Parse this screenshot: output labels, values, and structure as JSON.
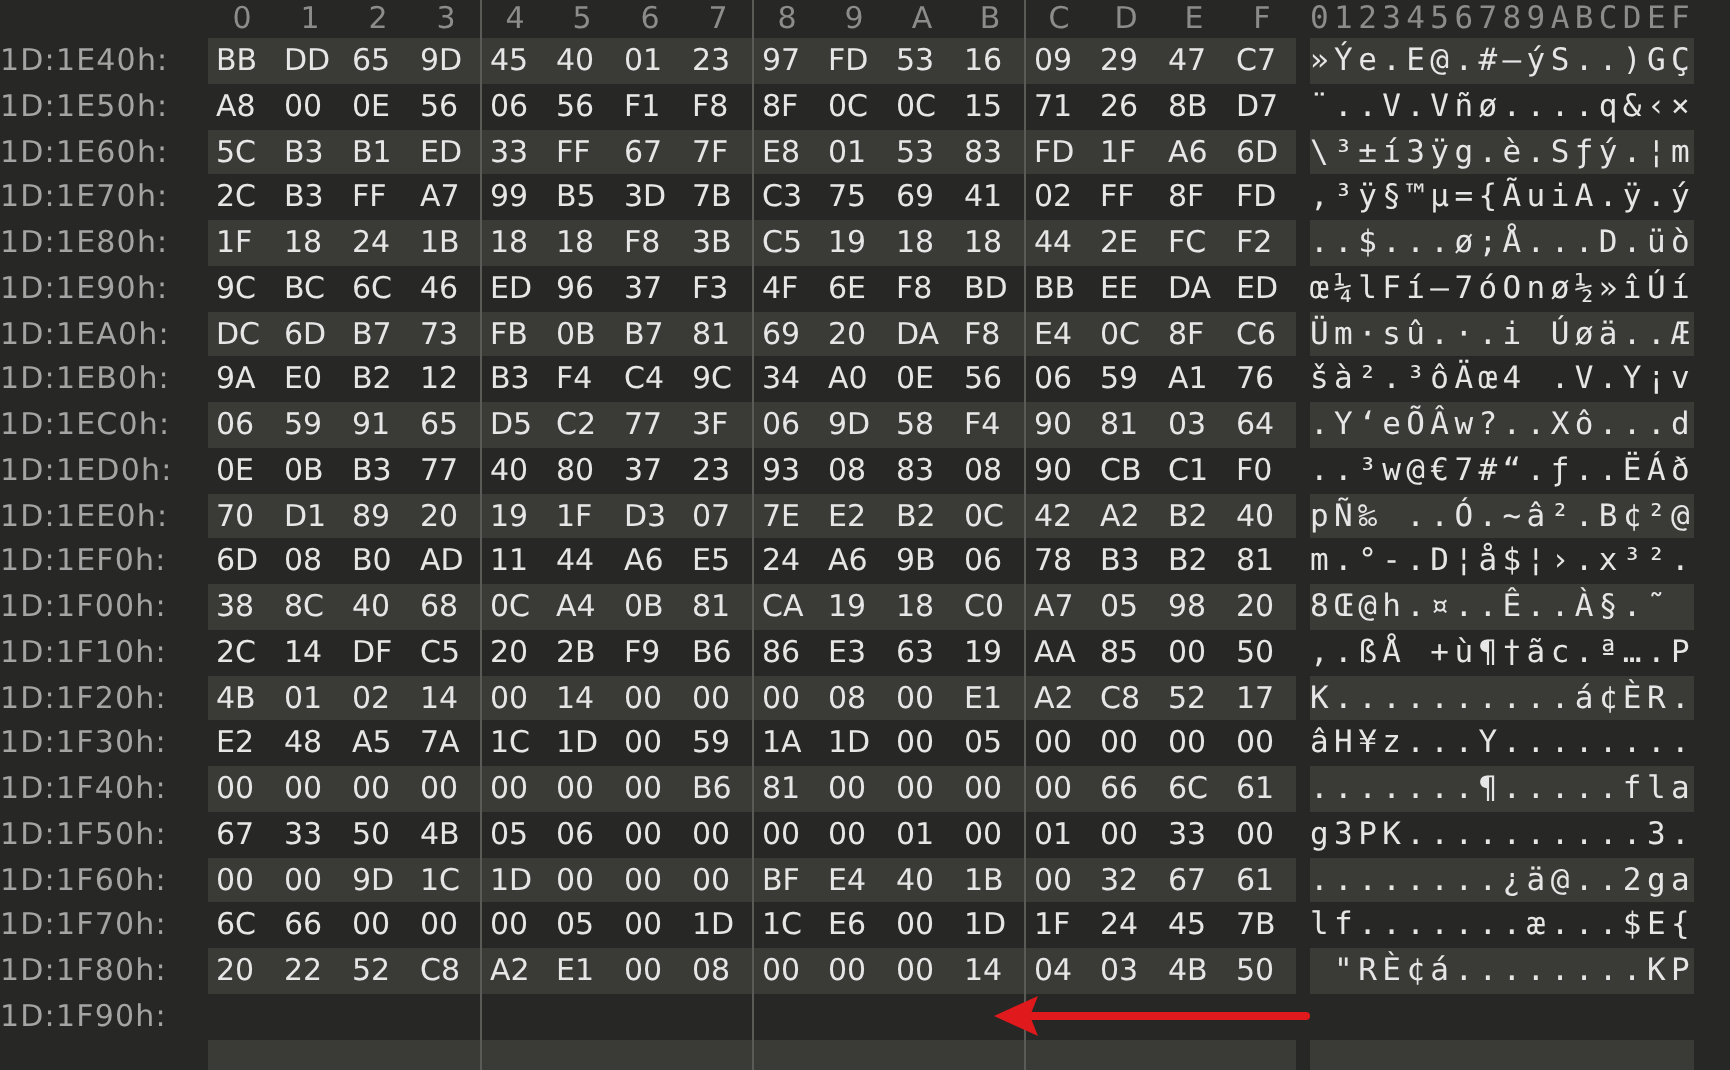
{
  "header": {
    "columns": [
      "0",
      "1",
      "2",
      "3",
      "4",
      "5",
      "6",
      "7",
      "8",
      "9",
      "A",
      "B",
      "C",
      "D",
      "E",
      "F"
    ],
    "ascii": "0123456789ABCDEF"
  },
  "rows": [
    {
      "address": "1D:1E40h:",
      "bytes": [
        "BB",
        "DD",
        "65",
        "9D",
        "45",
        "40",
        "01",
        "23",
        "97",
        "FD",
        "53",
        "16",
        "09",
        "29",
        "47",
        "C7"
      ],
      "ascii": "»Ýe.E@.#—ýS..)GÇ"
    },
    {
      "address": "1D:1E50h:",
      "bytes": [
        "A8",
        "00",
        "0E",
        "56",
        "06",
        "56",
        "F1",
        "F8",
        "8F",
        "0C",
        "0C",
        "15",
        "71",
        "26",
        "8B",
        "D7"
      ],
      "ascii": "¨..V.Vñø....q&‹×"
    },
    {
      "address": "1D:1E60h:",
      "bytes": [
        "5C",
        "B3",
        "B1",
        "ED",
        "33",
        "FF",
        "67",
        "7F",
        "E8",
        "01",
        "53",
        "83",
        "FD",
        "1F",
        "A6",
        "6D"
      ],
      "ascii": "\\³±í3ÿg.è.Sƒý.¦m"
    },
    {
      "address": "1D:1E70h:",
      "bytes": [
        "2C",
        "B3",
        "FF",
        "A7",
        "99",
        "B5",
        "3D",
        "7B",
        "C3",
        "75",
        "69",
        "41",
        "02",
        "FF",
        "8F",
        "FD"
      ],
      "ascii": ",³ÿ§™µ={ÃuiA.ÿ.ý"
    },
    {
      "address": "1D:1E80h:",
      "bytes": [
        "1F",
        "18",
        "24",
        "1B",
        "18",
        "18",
        "F8",
        "3B",
        "C5",
        "19",
        "18",
        "18",
        "44",
        "2E",
        "FC",
        "F2"
      ],
      "ascii": "..$...ø;Å...D.üò"
    },
    {
      "address": "1D:1E90h:",
      "bytes": [
        "9C",
        "BC",
        "6C",
        "46",
        "ED",
        "96",
        "37",
        "F3",
        "4F",
        "6E",
        "F8",
        "BD",
        "BB",
        "EE",
        "DA",
        "ED"
      ],
      "ascii": "œ¼lFí–7óOnø½»îÚí"
    },
    {
      "address": "1D:1EA0h:",
      "bytes": [
        "DC",
        "6D",
        "B7",
        "73",
        "FB",
        "0B",
        "B7",
        "81",
        "69",
        "20",
        "DA",
        "F8",
        "E4",
        "0C",
        "8F",
        "C6"
      ],
      "ascii": "Üm·sû.·.i Úøä..Æ"
    },
    {
      "address": "1D:1EB0h:",
      "bytes": [
        "9A",
        "E0",
        "B2",
        "12",
        "B3",
        "F4",
        "C4",
        "9C",
        "34",
        "A0",
        "0E",
        "56",
        "06",
        "59",
        "A1",
        "76"
      ],
      "ascii": "šà².³ôÄœ4 .V.Y¡v"
    },
    {
      "address": "1D:1EC0h:",
      "bytes": [
        "06",
        "59",
        "91",
        "65",
        "D5",
        "C2",
        "77",
        "3F",
        "06",
        "9D",
        "58",
        "F4",
        "90",
        "81",
        "03",
        "64"
      ],
      "ascii": ".Y‘eÕÂw?..Xô...d"
    },
    {
      "address": "1D:1ED0h:",
      "bytes": [
        "0E",
        "0B",
        "B3",
        "77",
        "40",
        "80",
        "37",
        "23",
        "93",
        "08",
        "83",
        "08",
        "90",
        "CB",
        "C1",
        "F0"
      ],
      "ascii": "..³w@€7#“.ƒ..ËÁð"
    },
    {
      "address": "1D:1EE0h:",
      "bytes": [
        "70",
        "D1",
        "89",
        "20",
        "19",
        "1F",
        "D3",
        "07",
        "7E",
        "E2",
        "B2",
        "0C",
        "42",
        "A2",
        "B2",
        "40"
      ],
      "ascii": "pÑ‰ ..Ó.~â².B¢²@"
    },
    {
      "address": "1D:1EF0h:",
      "bytes": [
        "6D",
        "08",
        "B0",
        "AD",
        "11",
        "44",
        "A6",
        "E5",
        "24",
        "A6",
        "9B",
        "06",
        "78",
        "B3",
        "B2",
        "81"
      ],
      "ascii": "m.°-.D¦å$¦›.x³²."
    },
    {
      "address": "1D:1F00h:",
      "bytes": [
        "38",
        "8C",
        "40",
        "68",
        "0C",
        "A4",
        "0B",
        "81",
        "CA",
        "19",
        "18",
        "C0",
        "A7",
        "05",
        "98",
        "20"
      ],
      "ascii": "8Œ@h.¤..Ê..À§.˜"
    },
    {
      "address": "1D:1F10h:",
      "bytes": [
        "2C",
        "14",
        "DF",
        "C5",
        "20",
        "2B",
        "F9",
        "B6",
        "86",
        "E3",
        "63",
        "19",
        "AA",
        "85",
        "00",
        "50"
      ],
      "ascii": ",.ßÅ +ù¶†ãc.ª….P"
    },
    {
      "address": "1D:1F20h:",
      "bytes": [
        "4B",
        "01",
        "02",
        "14",
        "00",
        "14",
        "00",
        "00",
        "00",
        "08",
        "00",
        "E1",
        "A2",
        "C8",
        "52",
        "17"
      ],
      "ascii": "K..........á¢ÈR."
    },
    {
      "address": "1D:1F30h:",
      "bytes": [
        "E2",
        "48",
        "A5",
        "7A",
        "1C",
        "1D",
        "00",
        "59",
        "1A",
        "1D",
        "00",
        "05",
        "00",
        "00",
        "00",
        "00"
      ],
      "ascii": "âH¥z...Y........"
    },
    {
      "address": "1D:1F40h:",
      "bytes": [
        "00",
        "00",
        "00",
        "00",
        "00",
        "00",
        "00",
        "B6",
        "81",
        "00",
        "00",
        "00",
        "00",
        "66",
        "6C",
        "61"
      ],
      "ascii": ".......¶.....fla"
    },
    {
      "address": "1D:1F50h:",
      "bytes": [
        "67",
        "33",
        "50",
        "4B",
        "05",
        "06",
        "00",
        "00",
        "00",
        "00",
        "01",
        "00",
        "01",
        "00",
        "33",
        "00"
      ],
      "ascii": "g3PK..........3."
    },
    {
      "address": "1D:1F60h:",
      "bytes": [
        "00",
        "00",
        "9D",
        "1C",
        "1D",
        "00",
        "00",
        "00",
        "BF",
        "E4",
        "40",
        "1B",
        "00",
        "32",
        "67",
        "61"
      ],
      "ascii": "........¿ä@..2ga"
    },
    {
      "address": "1D:1F70h:",
      "bytes": [
        "6C",
        "66",
        "00",
        "00",
        "00",
        "05",
        "00",
        "1D",
        "1C",
        "E6",
        "00",
        "1D",
        "1F",
        "24",
        "45",
        "7B"
      ],
      "ascii": "lf.......æ...$E{"
    },
    {
      "address": "1D:1F80h:",
      "bytes": [
        "20",
        "22",
        "52",
        "C8",
        "A2",
        "E1",
        "00",
        "08",
        "00",
        "00",
        "00",
        "14",
        "04",
        "03",
        "4B",
        "50"
      ],
      "ascii": " \"RÈ¢á........KP"
    },
    {
      "address": "1D:1F90h:"
    }
  ]
}
